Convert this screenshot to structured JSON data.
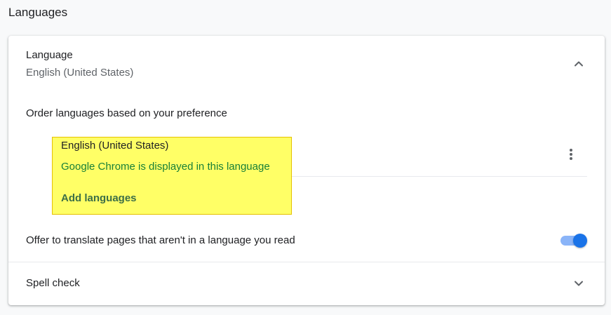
{
  "section": {
    "title": "Languages"
  },
  "language_panel": {
    "title": "Language",
    "current": "English (United States)",
    "order_label": "Order languages based on your preference",
    "items": [
      {
        "name": "English (United States)",
        "note": "Google Chrome is displayed in this language"
      }
    ],
    "add_label": "Add languages",
    "translate_label": "Offer to translate pages that aren't in a language you read",
    "translate_enabled": true
  },
  "spell_check": {
    "label": "Spell check"
  },
  "colors": {
    "accent": "#1a73e8",
    "toggle_track": "#8ab4f8",
    "note_green": "#188038",
    "highlight": "#ffff66"
  },
  "icons": {
    "collapse": "chevron-up-icon",
    "expand": "chevron-down-icon",
    "more": "more-vert-icon"
  }
}
